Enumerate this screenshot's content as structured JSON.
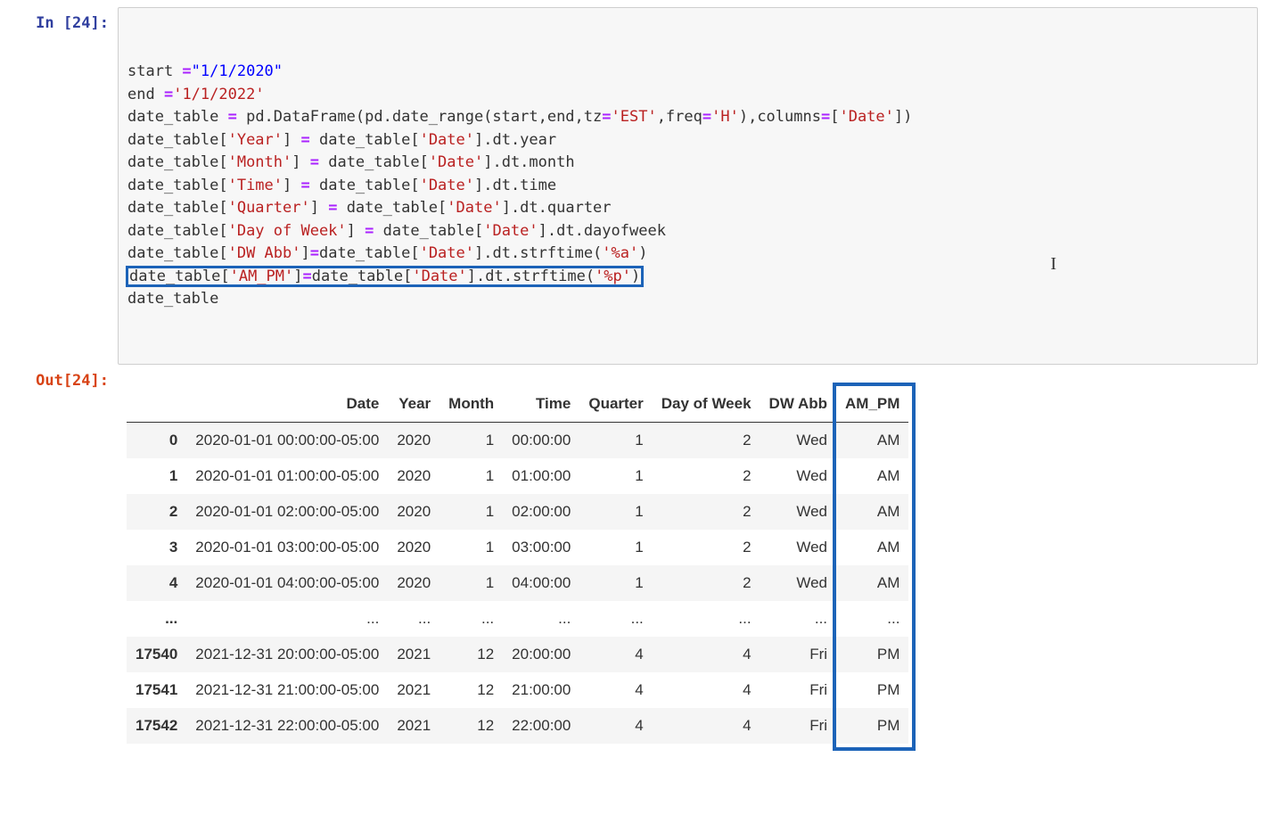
{
  "prompts": {
    "in": "In [24]:",
    "out": "Out[24]:"
  },
  "code_tokens": [
    [
      {
        "t": "start ",
        "c": "tok-text"
      },
      {
        "t": "=",
        "c": "tok-op"
      },
      {
        "t": "\"1/1/2020\"",
        "c": "tok-str2"
      }
    ],
    [
      {
        "t": "end ",
        "c": "tok-text"
      },
      {
        "t": "=",
        "c": "tok-op"
      },
      {
        "t": "'1/1/2022'",
        "c": "tok-str1"
      }
    ],
    [
      {
        "t": "date_table ",
        "c": "tok-text"
      },
      {
        "t": "=",
        "c": "tok-op"
      },
      {
        "t": " pd.DataFrame(pd.date_range(start,end,tz",
        "c": "tok-text"
      },
      {
        "t": "=",
        "c": "tok-op"
      },
      {
        "t": "'EST'",
        "c": "tok-str1"
      },
      {
        "t": ",freq",
        "c": "tok-text"
      },
      {
        "t": "=",
        "c": "tok-op"
      },
      {
        "t": "'H'",
        "c": "tok-str1"
      },
      {
        "t": "),columns",
        "c": "tok-text"
      },
      {
        "t": "=",
        "c": "tok-op"
      },
      {
        "t": "[",
        "c": "tok-text"
      },
      {
        "t": "'Date'",
        "c": "tok-str1"
      },
      {
        "t": "])",
        "c": "tok-text"
      }
    ],
    [
      {
        "t": "date_table[",
        "c": "tok-text"
      },
      {
        "t": "'Year'",
        "c": "tok-str1"
      },
      {
        "t": "] ",
        "c": "tok-text"
      },
      {
        "t": "=",
        "c": "tok-op"
      },
      {
        "t": " date_table[",
        "c": "tok-text"
      },
      {
        "t": "'Date'",
        "c": "tok-str1"
      },
      {
        "t": "].dt.year",
        "c": "tok-text"
      }
    ],
    [
      {
        "t": "date_table[",
        "c": "tok-text"
      },
      {
        "t": "'Month'",
        "c": "tok-str1"
      },
      {
        "t": "] ",
        "c": "tok-text"
      },
      {
        "t": "=",
        "c": "tok-op"
      },
      {
        "t": " date_table[",
        "c": "tok-text"
      },
      {
        "t": "'Date'",
        "c": "tok-str1"
      },
      {
        "t": "].dt.month",
        "c": "tok-text"
      }
    ],
    [
      {
        "t": "date_table[",
        "c": "tok-text"
      },
      {
        "t": "'Time'",
        "c": "tok-str1"
      },
      {
        "t": "] ",
        "c": "tok-text"
      },
      {
        "t": "=",
        "c": "tok-op"
      },
      {
        "t": " date_table[",
        "c": "tok-text"
      },
      {
        "t": "'Date'",
        "c": "tok-str1"
      },
      {
        "t": "].dt.time",
        "c": "tok-text"
      }
    ],
    [
      {
        "t": "date_table[",
        "c": "tok-text"
      },
      {
        "t": "'Quarter'",
        "c": "tok-str1"
      },
      {
        "t": "] ",
        "c": "tok-text"
      },
      {
        "t": "=",
        "c": "tok-op"
      },
      {
        "t": " date_table[",
        "c": "tok-text"
      },
      {
        "t": "'Date'",
        "c": "tok-str1"
      },
      {
        "t": "].dt.quarter",
        "c": "tok-text"
      }
    ],
    [
      {
        "t": "date_table[",
        "c": "tok-text"
      },
      {
        "t": "'Day of Week'",
        "c": "tok-str1"
      },
      {
        "t": "] ",
        "c": "tok-text"
      },
      {
        "t": "=",
        "c": "tok-op"
      },
      {
        "t": " date_table[",
        "c": "tok-text"
      },
      {
        "t": "'Date'",
        "c": "tok-str1"
      },
      {
        "t": "].dt.dayofweek",
        "c": "tok-text"
      }
    ],
    [
      {
        "t": "date_table[",
        "c": "tok-text"
      },
      {
        "t": "'DW Abb'",
        "c": "tok-str1"
      },
      {
        "t": "]",
        "c": "tok-text"
      },
      {
        "t": "=",
        "c": "tok-op"
      },
      {
        "t": "date_table[",
        "c": "tok-text"
      },
      {
        "t": "'Date'",
        "c": "tok-str1"
      },
      {
        "t": "].dt.strftime(",
        "c": "tok-text"
      },
      {
        "t": "'%a'",
        "c": "tok-str1"
      },
      {
        "t": ")",
        "c": "tok-text"
      }
    ],
    [
      {
        "t": "date_table[",
        "c": "tok-text",
        "hl": true
      },
      {
        "t": "'AM_PM'",
        "c": "tok-str1",
        "hl": true
      },
      {
        "t": "]",
        "c": "tok-text",
        "hl": true
      },
      {
        "t": "=",
        "c": "tok-op",
        "hl": true
      },
      {
        "t": "date_table[",
        "c": "tok-text",
        "hl": true
      },
      {
        "t": "'Date'",
        "c": "tok-str1",
        "hl": true
      },
      {
        "t": "].dt.strftime(",
        "c": "tok-text",
        "hl": true
      },
      {
        "t": "'%p'",
        "c": "tok-str1",
        "hl": true
      },
      {
        "t": ")",
        "c": "tok-text",
        "hl": true
      }
    ],
    [
      {
        "t": "date_table",
        "c": "tok-text"
      }
    ]
  ],
  "table": {
    "columns": [
      "",
      "Date",
      "Year",
      "Month",
      "Time",
      "Quarter",
      "Day of Week",
      "DW Abb",
      "AM_PM"
    ],
    "rows": [
      [
        "0",
        "2020-01-01 00:00:00-05:00",
        "2020",
        "1",
        "00:00:00",
        "1",
        "2",
        "Wed",
        "AM"
      ],
      [
        "1",
        "2020-01-01 01:00:00-05:00",
        "2020",
        "1",
        "01:00:00",
        "1",
        "2",
        "Wed",
        "AM"
      ],
      [
        "2",
        "2020-01-01 02:00:00-05:00",
        "2020",
        "1",
        "02:00:00",
        "1",
        "2",
        "Wed",
        "AM"
      ],
      [
        "3",
        "2020-01-01 03:00:00-05:00",
        "2020",
        "1",
        "03:00:00",
        "1",
        "2",
        "Wed",
        "AM"
      ],
      [
        "4",
        "2020-01-01 04:00:00-05:00",
        "2020",
        "1",
        "04:00:00",
        "1",
        "2",
        "Wed",
        "AM"
      ],
      [
        "...",
        "...",
        "...",
        "...",
        "...",
        "...",
        "...",
        "...",
        "..."
      ],
      [
        "17540",
        "2021-12-31 20:00:00-05:00",
        "2021",
        "12",
        "20:00:00",
        "4",
        "4",
        "Fri",
        "PM"
      ],
      [
        "17541",
        "2021-12-31 21:00:00-05:00",
        "2021",
        "12",
        "21:00:00",
        "4",
        "4",
        "Fri",
        "PM"
      ],
      [
        "17542",
        "2021-12-31 22:00:00-05:00",
        "2021",
        "12",
        "22:00:00",
        "4",
        "4",
        "Fri",
        "PM"
      ]
    ]
  }
}
